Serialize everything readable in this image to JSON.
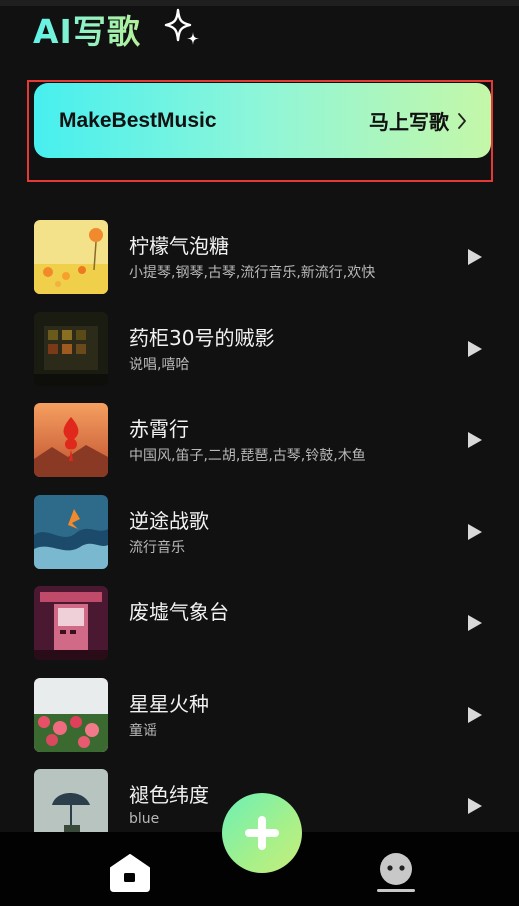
{
  "app": {
    "title": "AI写歌"
  },
  "banner": {
    "brand": "MakeBestMusic",
    "cta": "马上写歌"
  },
  "songs": [
    {
      "title": "柠檬气泡糖",
      "tags": "小提琴,钢琴,古琴,流行音乐,新流行,欢快"
    },
    {
      "title": "药柜30号的贼影",
      "tags": "说唱,嘻哈"
    },
    {
      "title": "赤霄行",
      "tags": "中国风,笛子,二胡,琵琶,古琴,铃鼓,木鱼"
    },
    {
      "title": "逆途战歌",
      "tags": "流行音乐"
    },
    {
      "title": "废墟气象台",
      "tags": ""
    },
    {
      "title": "星星火种",
      "tags": "童谣"
    },
    {
      "title": "褪色纬度",
      "tags": "blue"
    }
  ],
  "icons": {
    "sparkle": "sparkle-icon",
    "chevron": "chevron-right-icon",
    "play": "play-icon",
    "home": "home-icon",
    "add": "plus-icon",
    "profile": "robot-face-icon"
  },
  "colors": {
    "background": "#111111",
    "accent_start": "#47efef",
    "accent_end": "#c4f7a8",
    "highlight_outline": "#e53935"
  }
}
